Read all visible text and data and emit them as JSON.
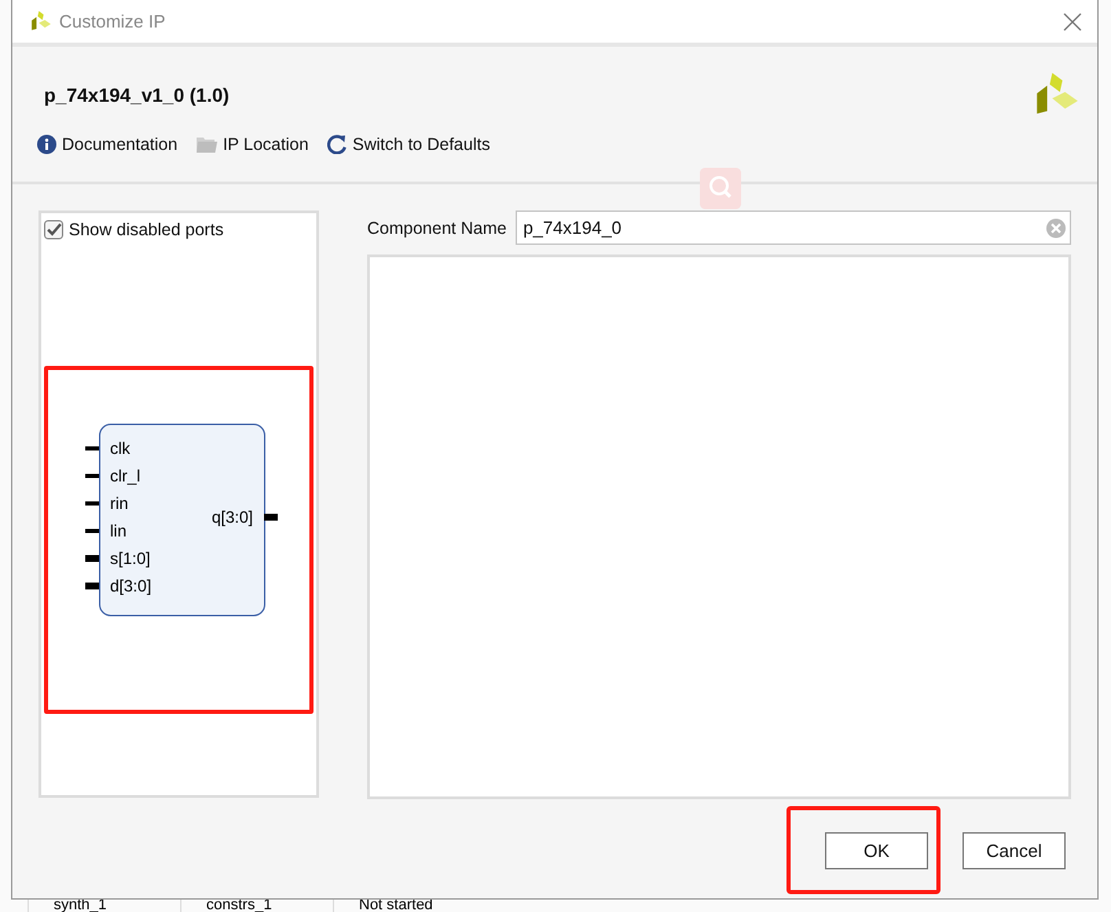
{
  "window": {
    "title": "Customize IP"
  },
  "header": {
    "ip_name": "p_74x194_v1_0 (1.0)"
  },
  "toolbar": [
    {
      "label": "Documentation",
      "kind": "info"
    },
    {
      "label": "IP Location",
      "kind": "folder"
    },
    {
      "label": "Switch to Defaults",
      "kind": "refresh"
    }
  ],
  "symbol_panel": {
    "show_disabled_ports": {
      "label": "Show disabled ports",
      "checked": true
    },
    "symbol": {
      "highlighted": true,
      "inputs": [
        {
          "name": "clk",
          "bus": false
        },
        {
          "name": "clr_l",
          "bus": false
        },
        {
          "name": "rin",
          "bus": false
        },
        {
          "name": "lin",
          "bus": false
        },
        {
          "name": "s[1:0]",
          "bus": true
        },
        {
          "name": "d[3:0]",
          "bus": true
        }
      ],
      "outputs": [
        {
          "name": "q[3:0]",
          "bus": true
        }
      ]
    }
  },
  "component_name": {
    "label": "Component Name",
    "value": "p_74x194_0"
  },
  "buttons": [
    {
      "label": "OK",
      "highlighted": true
    },
    {
      "label": "Cancel",
      "highlighted": false
    }
  ],
  "background": {
    "bottom_row": [
      "synth_1",
      "constrs_1",
      "Not started"
    ]
  }
}
